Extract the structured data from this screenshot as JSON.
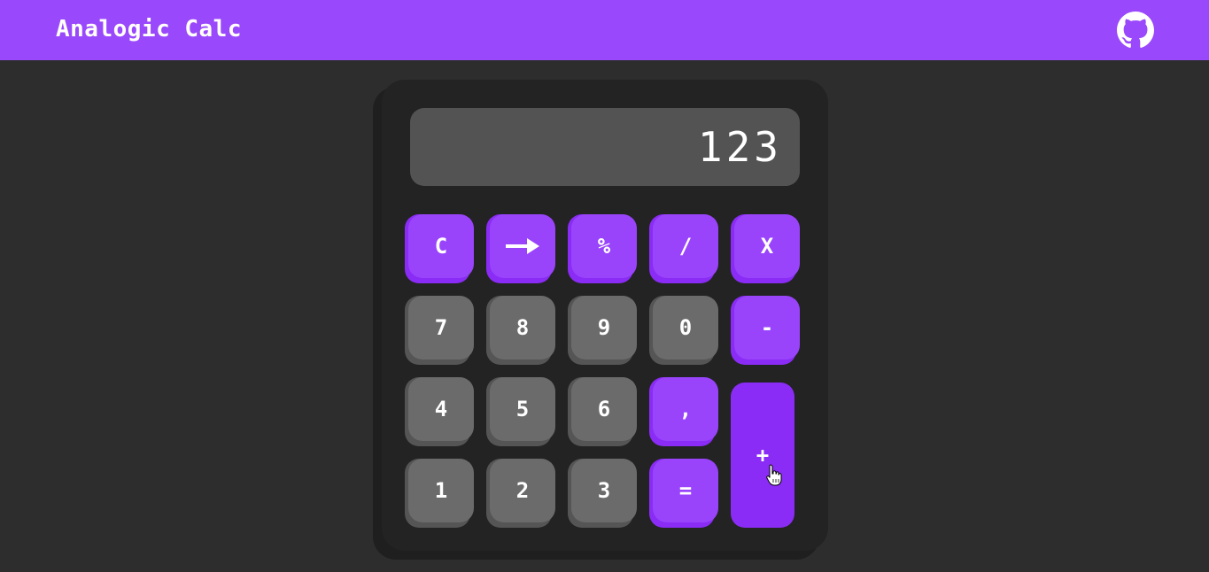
{
  "header": {
    "app_title": "Analogic Calc",
    "github_icon": "github-icon",
    "bar_color": "#9a48fb"
  },
  "display": {
    "value": "123"
  },
  "keys": {
    "clear": "C",
    "backspace_icon": "arrow-right-icon",
    "percent": "%",
    "divide": "/",
    "multiply": "X",
    "seven": "7",
    "eight": "8",
    "nine": "9",
    "zero": "0",
    "minus": "-",
    "four": "4",
    "five": "5",
    "six": "6",
    "comma": ",",
    "one": "1",
    "two": "2",
    "three": "3",
    "equals": "=",
    "plus": "+"
  },
  "colors": {
    "accent": "#9944fb",
    "accent_dark": "#8a2cf5",
    "number_key": "#6b6b6b",
    "display_bg": "#535353",
    "body_bg": "#2d2d2d"
  }
}
